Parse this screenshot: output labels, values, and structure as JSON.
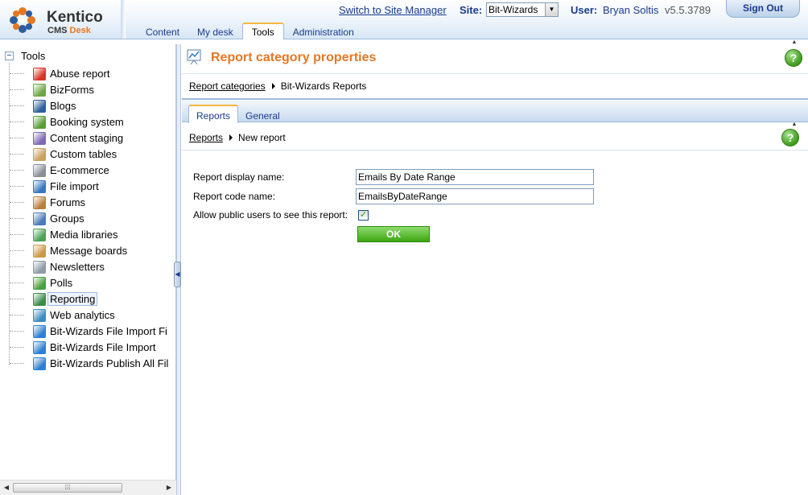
{
  "header": {
    "logo_name": "Kentico",
    "logo_sub_prefix": "CMS",
    "logo_sub_accent": "Desk",
    "switch_link": "Switch to Site Manager",
    "site_label": "Site:",
    "site_value": "Bit-Wizards",
    "user_label": "User:",
    "user_name": "Bryan Soltis",
    "version": "v5.5.3789",
    "signout": "Sign Out",
    "tabs": [
      {
        "label": "Content"
      },
      {
        "label": "My desk"
      },
      {
        "label": "Tools"
      },
      {
        "label": "Administration"
      }
    ],
    "active_tab": "Tools"
  },
  "tree": {
    "root_label": "Tools",
    "expander": "−",
    "items": [
      {
        "label": "Abuse report",
        "icon": "abuse-report-icon",
        "color": "#d9342b"
      },
      {
        "label": "BizForms",
        "icon": "bizforms-icon",
        "color": "#6fa64a"
      },
      {
        "label": "Blogs",
        "icon": "blogs-icon",
        "color": "#2f5f9e"
      },
      {
        "label": "Booking system",
        "icon": "booking-system-icon",
        "color": "#5a9e3a"
      },
      {
        "label": "Content staging",
        "icon": "content-staging-icon",
        "color": "#7d6ab0"
      },
      {
        "label": "Custom tables",
        "icon": "custom-tables-icon",
        "color": "#c8a160"
      },
      {
        "label": "E-commerce",
        "icon": "ecommerce-icon",
        "color": "#8a8f99"
      },
      {
        "label": "File import",
        "icon": "file-import-icon",
        "color": "#3a74c2"
      },
      {
        "label": "Forums",
        "icon": "forums-icon",
        "color": "#b5803c"
      },
      {
        "label": "Groups",
        "icon": "groups-icon",
        "color": "#4d7ab8"
      },
      {
        "label": "Media libraries",
        "icon": "media-libraries-icon",
        "color": "#4f9f56"
      },
      {
        "label": "Message boards",
        "icon": "message-boards-icon",
        "color": "#c99a44"
      },
      {
        "label": "Newsletters",
        "icon": "newsletters-icon",
        "color": "#8d9aa8"
      },
      {
        "label": "Polls",
        "icon": "polls-icon",
        "color": "#4aa040"
      },
      {
        "label": "Reporting",
        "icon": "reporting-icon",
        "color": "#3c8b4a"
      },
      {
        "label": "Web analytics",
        "icon": "web-analytics-icon",
        "color": "#3f8cbf"
      },
      {
        "label": "Bit-Wizards File Import Fi",
        "icon": "cube-icon",
        "color": "#2b7fd6"
      },
      {
        "label": "Bit-Wizards File Import",
        "icon": "cube-icon",
        "color": "#2b7fd6"
      },
      {
        "label": "Bit-Wizards Publish All Fil",
        "icon": "cube-icon",
        "color": "#2b7fd6"
      }
    ],
    "selected": "Reporting"
  },
  "content": {
    "page_title": "Report category properties",
    "help": "?",
    "breadcrumb1": {
      "link": "Report categories",
      "current": "Bit-Wizards Reports"
    },
    "tabs": [
      {
        "label": "Reports"
      },
      {
        "label": "General"
      }
    ],
    "active_tab": "Reports",
    "breadcrumb2": {
      "link": "Reports",
      "current": "New report"
    },
    "form": {
      "display_name_label": "Report display name:",
      "display_name_value": "Emails By Date Range",
      "code_name_label": "Report code name:",
      "code_name_value": "EmailsByDateRange",
      "public_label": "Allow public users to see this report:",
      "public_checked": "✓",
      "ok": "OK"
    }
  },
  "colors": {
    "accent": "#e87722",
    "link": "#1a3a8c",
    "ok_green": "#3da513"
  }
}
